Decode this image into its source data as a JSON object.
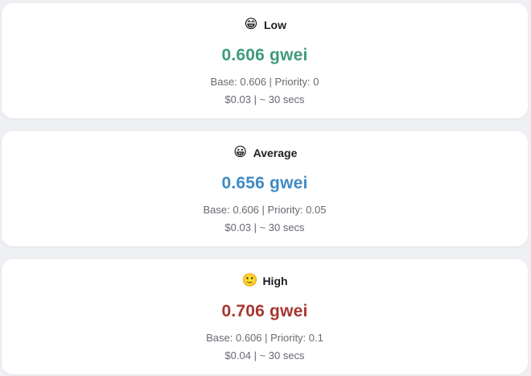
{
  "gas_tiers": [
    {
      "icon": "grinning-face-icon",
      "emoji": "😁",
      "label": "Low",
      "price": "0.606 gwei",
      "breakdown": "Base: 0.606 | Priority: 0",
      "cost_time": "$0.03 | ~ 30 secs",
      "color": "#3e9b7a"
    },
    {
      "icon": "smiley-face-icon",
      "emoji": "😀",
      "label": "Average",
      "price": "0.656 gwei",
      "breakdown": "Base: 0.606 | Priority: 0.05",
      "cost_time": "$0.03 | ~ 30 secs",
      "color": "#3f8ac4"
    },
    {
      "icon": "slightly-smiling-face-icon",
      "emoji": "🙂",
      "label": "High",
      "price": "0.706 gwei",
      "breakdown": "Base: 0.606 | Priority: 0.1",
      "cost_time": "$0.04 | ~ 30 secs",
      "color": "#a8362f"
    }
  ]
}
